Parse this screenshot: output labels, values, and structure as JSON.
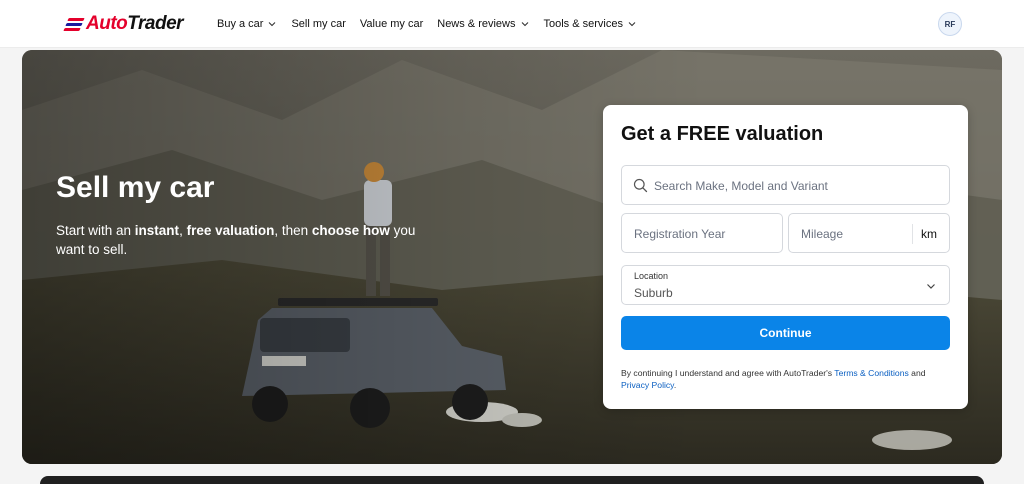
{
  "header": {
    "logo": {
      "part1": "Auto",
      "part2": "Trader",
      "colors": {
        "red": "#e4002b",
        "navy": "#1a1a9e"
      }
    },
    "nav": [
      {
        "label": "Buy a car",
        "dropdown": true
      },
      {
        "label": "Sell my car",
        "dropdown": false
      },
      {
        "label": "Value my car",
        "dropdown": false
      },
      {
        "label": "News & reviews",
        "dropdown": true
      },
      {
        "label": "Tools & services",
        "dropdown": true
      }
    ],
    "avatar_initials": "RF"
  },
  "hero": {
    "title": "Sell my car",
    "subtitle": {
      "part1": "Start with an ",
      "bold1": "instant",
      "part2": ", ",
      "bold2": "free valuation",
      "part3": ", then ",
      "bold3": "choose how",
      "part4": " you want to sell."
    }
  },
  "valuation_form": {
    "title": "Get a FREE valuation",
    "search": {
      "placeholder": "Search Make, Model and Variant",
      "icon": "search-icon"
    },
    "registration_year": {
      "placeholder": "Registration Year"
    },
    "mileage": {
      "placeholder": "Mileage",
      "unit": "km"
    },
    "location": {
      "label": "Location",
      "value": "Suburb"
    },
    "continue_label": "Continue",
    "terms": {
      "prefix": "By continuing I understand and agree with AutoTrader's ",
      "terms_link": "Terms & Conditions",
      "and": " and ",
      "privacy_link": "Privacy Policy",
      "suffix": "."
    },
    "accent_color": "#0a84e8"
  }
}
